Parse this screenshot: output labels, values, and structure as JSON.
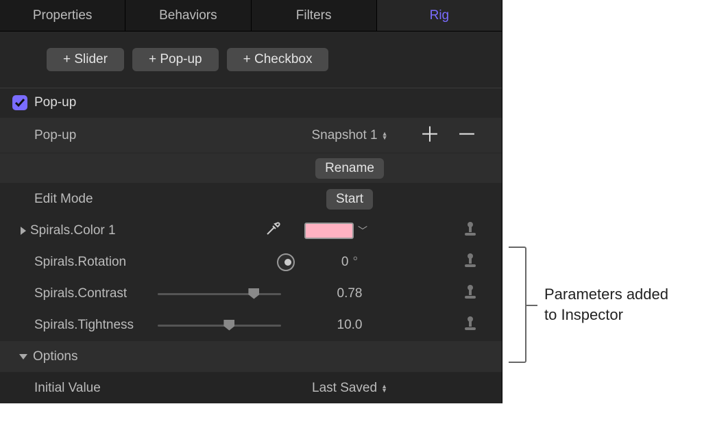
{
  "tabs": {
    "t0": "Properties",
    "t1": "Behaviors",
    "t2": "Filters",
    "t3": "Rig"
  },
  "add": {
    "slider": "+ Slider",
    "popup": "+ Pop-up",
    "checkbox": "+ Checkbox"
  },
  "section": {
    "title": "Pop-up"
  },
  "popup_row": {
    "label": "Pop-up",
    "value": "Snapshot 1"
  },
  "rename_btn": "Rename",
  "editmode": {
    "label": "Edit Mode",
    "btn": "Start"
  },
  "params": {
    "color": {
      "label": "Spirals.Color 1",
      "swatch_hex": "#ffb2c2"
    },
    "rotation": {
      "label": "Spirals.Rotation",
      "value": "0",
      "unit": "°"
    },
    "contrast": {
      "label": "Spirals.Contrast",
      "value": "0.78",
      "slider_pct": 78
    },
    "tightness": {
      "label": "Spirals.Tightness",
      "value": "10.0",
      "slider_pct": 58
    }
  },
  "options": {
    "header": "Options",
    "initial_label": "Initial Value",
    "initial_value": "Last Saved"
  },
  "callout": {
    "line1": "Parameters added",
    "line2": "to Inspector"
  }
}
